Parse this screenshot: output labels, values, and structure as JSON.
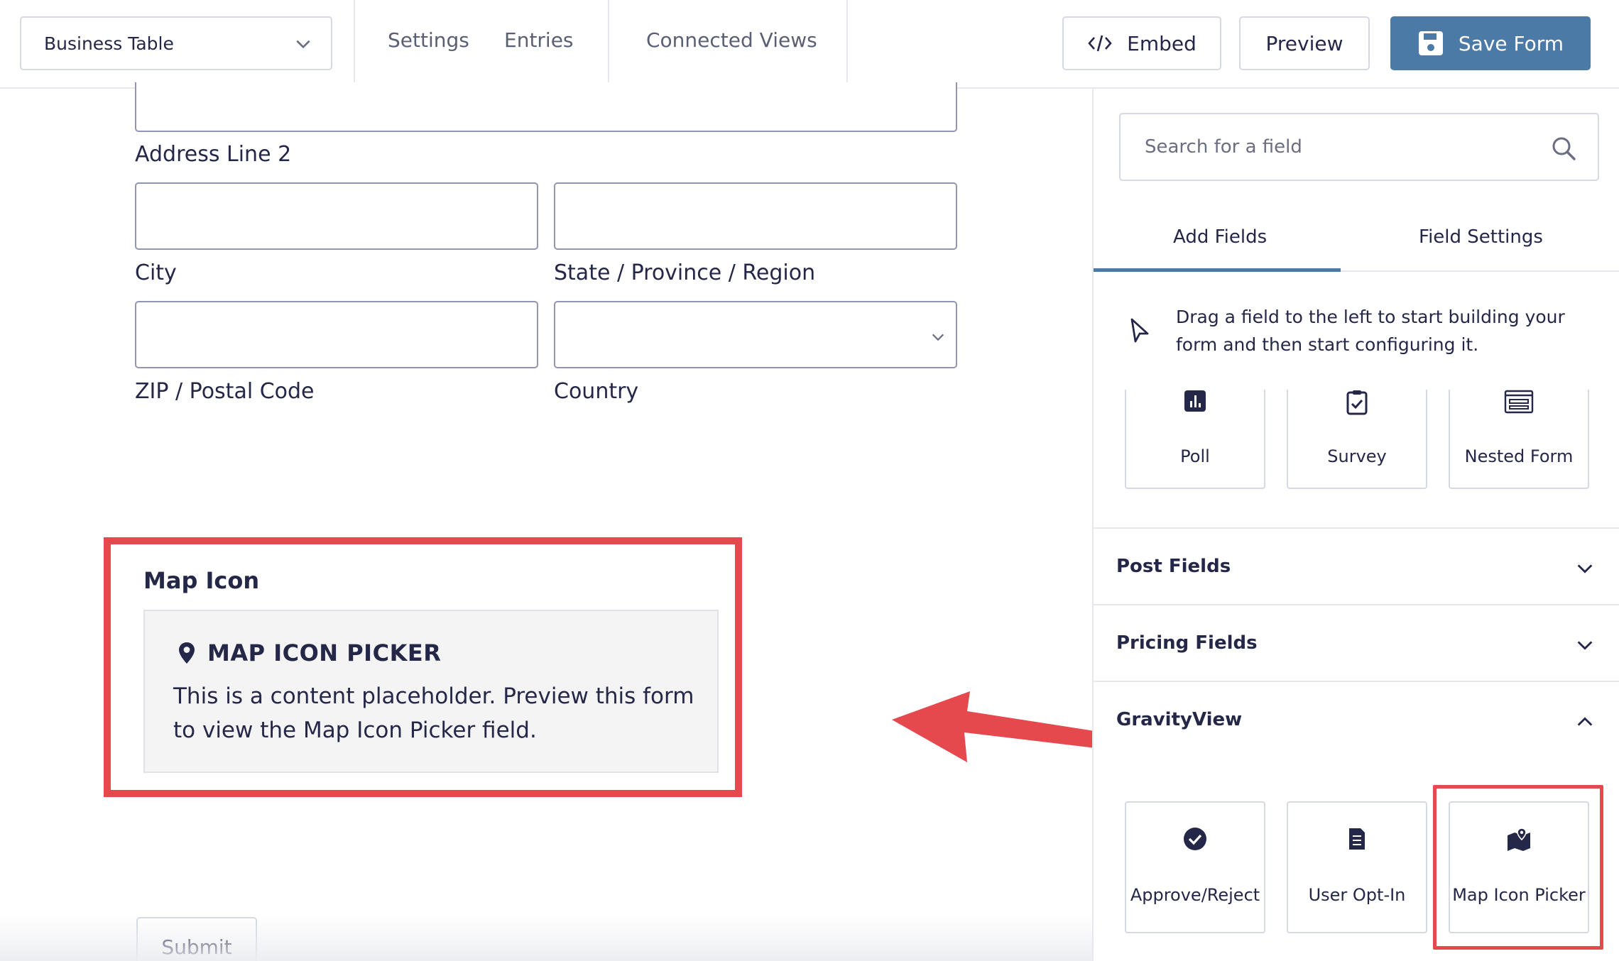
{
  "header": {
    "form_select_value": "Business Table",
    "nav": {
      "settings": "Settings",
      "entries": "Entries",
      "connected_views": "Connected Views"
    },
    "embed_label": "Embed",
    "preview_label": "Preview",
    "save_label": "Save Form"
  },
  "form": {
    "address_line2_label": "Address Line 2",
    "city_label": "City",
    "state_label": "State / Province / Region",
    "zip_label": "ZIP / Postal Code",
    "country_label": "Country",
    "map_field": {
      "title": "Map Icon",
      "placeholder_heading": "MAP ICON PICKER",
      "placeholder_text": "This is a content placeholder. Preview this form to view the Map Icon Picker field."
    },
    "submit_label": "Submit"
  },
  "sidebar": {
    "search_placeholder": "Search for a field",
    "tabs": {
      "add_fields": "Add Fields",
      "field_settings": "Field Settings"
    },
    "hint": "Drag a field to the left to start building your form and then start configuring it.",
    "top_tiles": [
      {
        "label": "Poll",
        "icon": "poll-icon"
      },
      {
        "label": "Survey",
        "icon": "survey-icon"
      },
      {
        "label": "Nested Form",
        "icon": "nested-form-icon"
      }
    ],
    "groups": {
      "post_fields": "Post Fields",
      "pricing_fields": "Pricing Fields",
      "gravityview": "GravityView"
    },
    "gravityview_tiles": [
      {
        "label": "Approve/Reject",
        "icon": "check-circle-icon"
      },
      {
        "label": "User Opt-In",
        "icon": "document-icon"
      },
      {
        "label": "Map Icon Picker",
        "icon": "map-pin-icon"
      }
    ]
  },
  "colors": {
    "accent": "#4a7aa5",
    "highlight": "#e5484d",
    "text": "#242748"
  }
}
